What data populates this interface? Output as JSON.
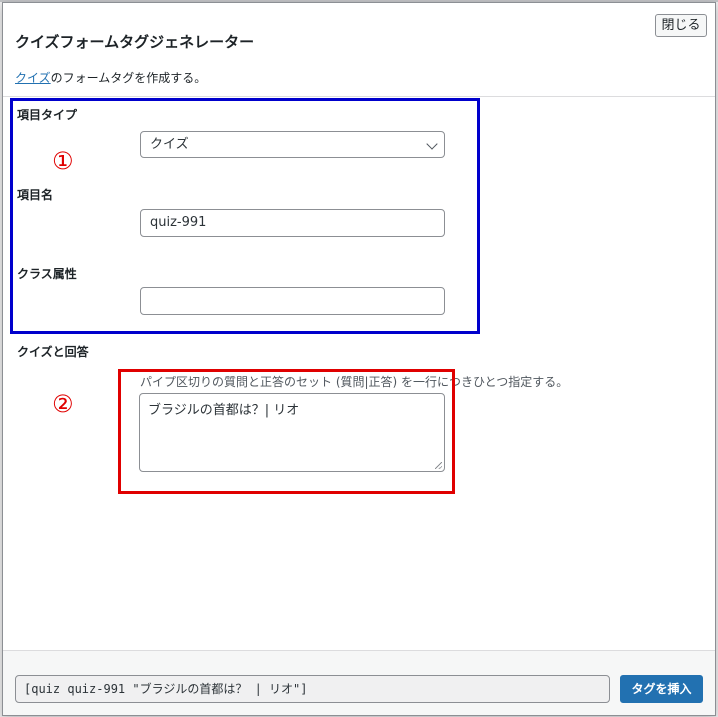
{
  "dialog": {
    "title": "クイズフォームタグジェネレーター",
    "close_label": "閉じる",
    "description_link": "クイズ",
    "description_rest": "のフォームタグを作成する。"
  },
  "fields": {
    "type_label": "項目タイプ",
    "type_value": "クイズ",
    "name_label": "項目名",
    "name_value": "quiz-991",
    "class_label": "クラス属性",
    "class_value": "",
    "qa_label": "クイズと回答",
    "qa_hint": "パイプ区切りの質問と正答のセット (質問|正答) を一行につきひとつ指定する。",
    "qa_value": "ブラジルの首都は？| リオ"
  },
  "annotations": {
    "marker_1": "①",
    "marker_2": "②"
  },
  "footer": {
    "tag_code": "[quiz quiz-991 \"ブラジルの首都は？ | リオ\"]",
    "insert_label": "タグを挿入"
  },
  "colors": {
    "accent": "#2271b1",
    "annotation_blue": "#0000cc",
    "annotation_red": "#e00000"
  }
}
